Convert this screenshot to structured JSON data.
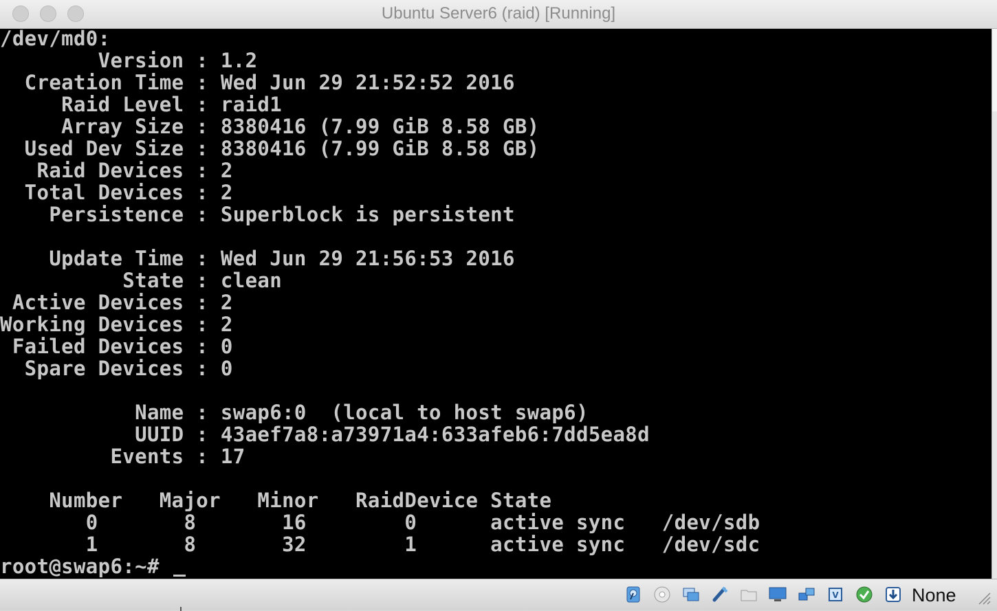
{
  "window": {
    "title": "Ubuntu Server6 (raid) [Running]"
  },
  "terminal": {
    "lines": [
      "/dev/md0:",
      "        Version : 1.2",
      "  Creation Time : Wed Jun 29 21:52:52 2016",
      "     Raid Level : raid1",
      "     Array Size : 8380416 (7.99 GiB 8.58 GB)",
      "  Used Dev Size : 8380416 (7.99 GiB 8.58 GB)",
      "   Raid Devices : 2",
      "  Total Devices : 2",
      "    Persistence : Superblock is persistent",
      "",
      "    Update Time : Wed Jun 29 21:56:53 2016",
      "          State : clean",
      " Active Devices : 2",
      "Working Devices : 2",
      " Failed Devices : 0",
      "  Spare Devices : 0",
      "",
      "           Name : swap6:0  (local to host swap6)",
      "           UUID : 43aef7a8:a73971a4:633afeb6:7dd5ea8d",
      "         Events : 17",
      "",
      "    Number   Major   Minor   RaidDevice State",
      "       0       8       16        0      active sync   /dev/sdb",
      "       1       8       32        1      active sync   /dev/sdc",
      "root@swap6:~# "
    ]
  },
  "statusbar": {
    "host_key": "None",
    "icons": [
      "hard-disk-icon",
      "optical-drive-icon",
      "audio-icon",
      "usb-icon",
      "shared-folders-icon",
      "display-icon",
      "network-icon",
      "cpu-vtx-icon",
      "mouse-integration-icon",
      "host-key-icon"
    ]
  }
}
